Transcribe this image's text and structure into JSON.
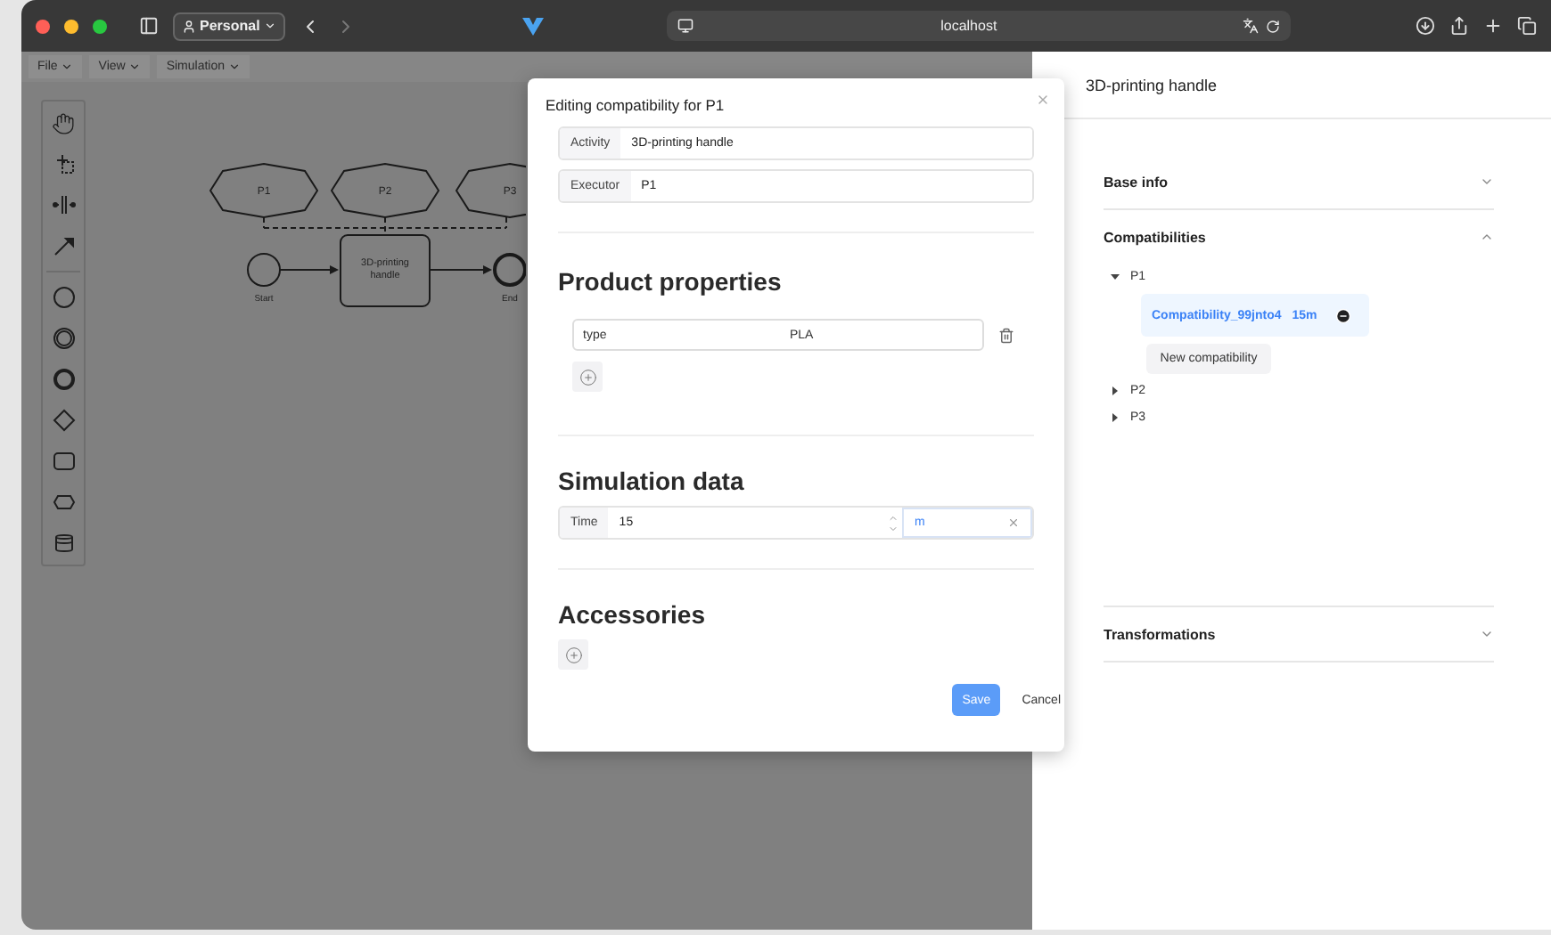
{
  "browser": {
    "profile": "Personal",
    "url": "localhost"
  },
  "menu": [
    {
      "label": "File"
    },
    {
      "label": "View"
    },
    {
      "label": "Simulation"
    }
  ],
  "palette": [
    {
      "kind": "hand"
    },
    {
      "kind": "lasso"
    },
    {
      "kind": "space"
    },
    {
      "kind": "connect"
    },
    {
      "kind": "separator"
    },
    {
      "kind": "start-event"
    },
    {
      "kind": "intermediate-event"
    },
    {
      "kind": "end-event"
    },
    {
      "kind": "gateway"
    },
    {
      "kind": "task"
    },
    {
      "kind": "participant"
    },
    {
      "kind": "data-store"
    }
  ],
  "diagram": {
    "participants": [
      {
        "label": "P1"
      },
      {
        "label": "P2"
      },
      {
        "label": "P3"
      }
    ],
    "start": {
      "label": "Start"
    },
    "task": {
      "label": "3D-printing handle"
    },
    "end": {
      "label": "End"
    }
  },
  "modal": {
    "title": "Editing compatibility for P1",
    "fields": [
      {
        "label": "Activity",
        "value": "3D-printing handle"
      },
      {
        "label": "Executor",
        "value": "P1"
      }
    ],
    "product_properties": {
      "heading": "Product properties",
      "rows": [
        {
          "key": "type",
          "value": "PLA"
        }
      ]
    },
    "simulation": {
      "heading": "Simulation data",
      "time_label": "Time",
      "time_value": "15",
      "unit": "m"
    },
    "accessories": {
      "heading": "Accessories"
    },
    "save": "Save",
    "cancel": "Cancel"
  },
  "panel": {
    "title": "3D-printing handle",
    "sections": [
      {
        "title": "Base info",
        "expanded": false
      },
      {
        "title": "Compatibilities",
        "expanded": true,
        "tree": [
          {
            "label": "P1",
            "expanded": true,
            "compatibilities": [
              {
                "name": "Compatibility_99jnto4",
                "time": "15m"
              }
            ],
            "new_button": "New compatibility"
          },
          {
            "label": "P2",
            "expanded": false
          },
          {
            "label": "P3",
            "expanded": false
          }
        ]
      },
      {
        "title": "Transformations",
        "expanded": false
      }
    ]
  }
}
